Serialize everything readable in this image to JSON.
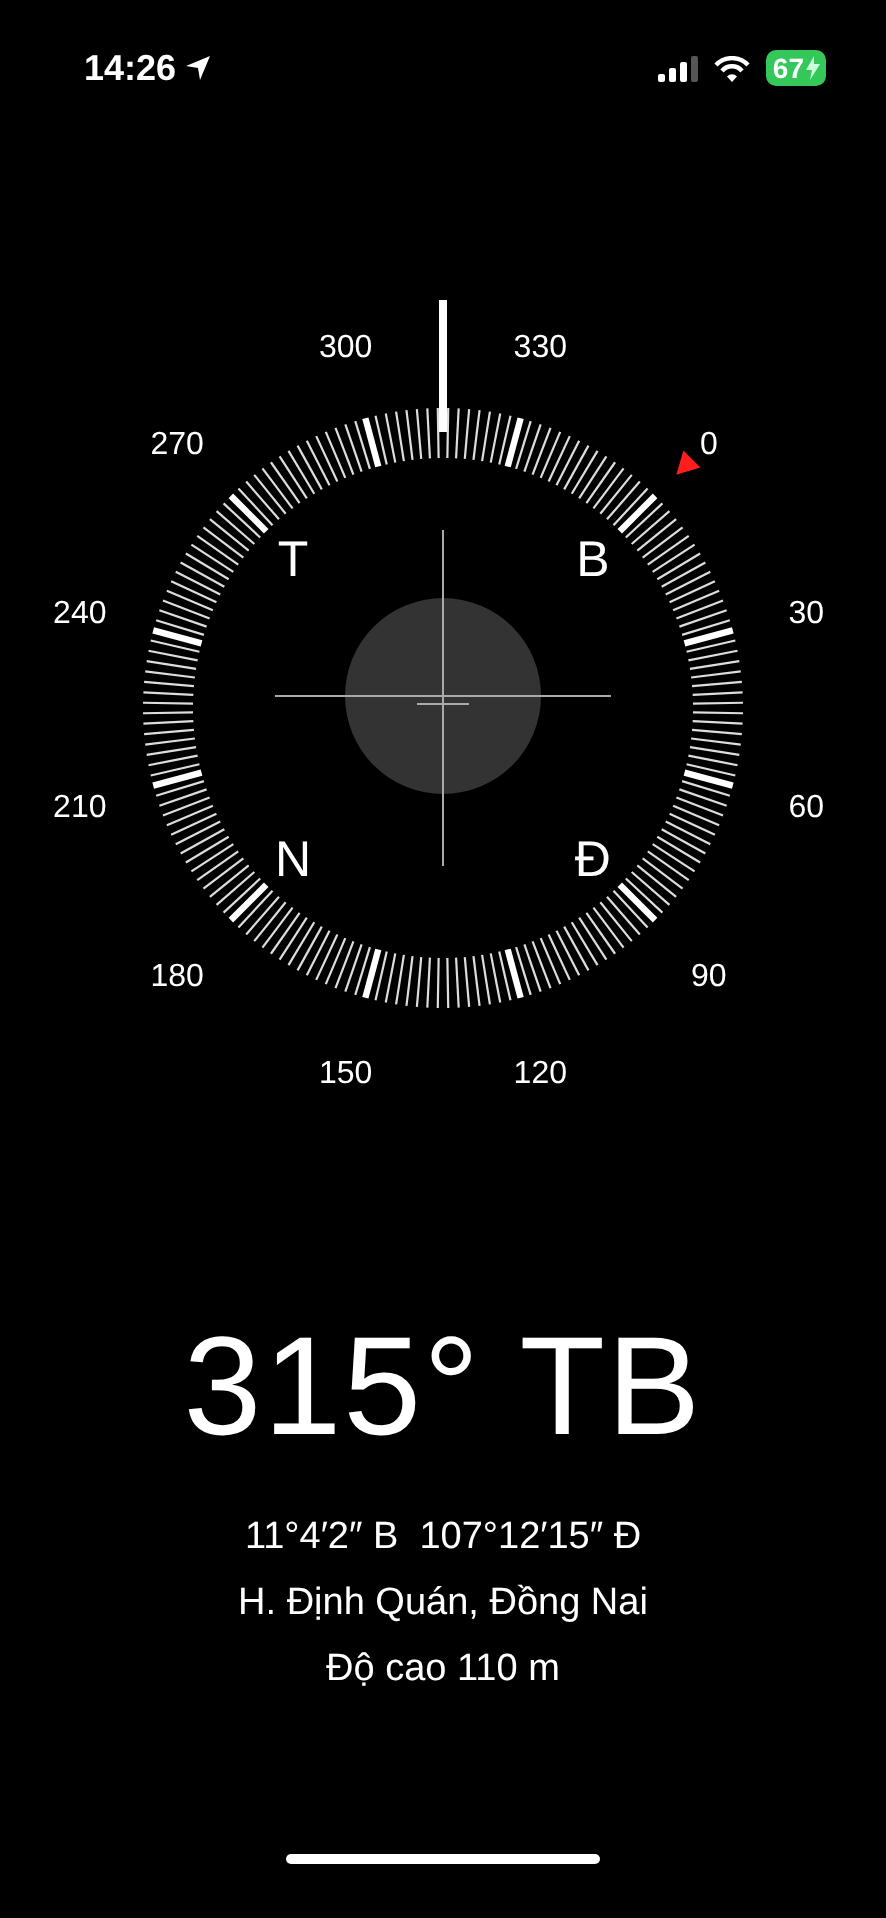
{
  "status_bar": {
    "time": "14:26",
    "battery": "67"
  },
  "compass": {
    "dial_labels": [
      {
        "text": "0"
      },
      {
        "text": "30"
      },
      {
        "text": "60"
      },
      {
        "text": "90"
      },
      {
        "text": "120"
      },
      {
        "text": "150"
      },
      {
        "text": "180"
      },
      {
        "text": "210"
      },
      {
        "text": "240"
      },
      {
        "text": "270"
      },
      {
        "text": "300"
      },
      {
        "text": "330"
      }
    ],
    "cardinals": [
      {
        "text": "T"
      },
      {
        "text": "B"
      },
      {
        "text": "N"
      },
      {
        "text": "Đ"
      }
    ]
  },
  "heading": "315° TB",
  "coordinates": {
    "latitude": "11°4′2″ B",
    "longitude": "107°12′15″ Đ"
  },
  "location": "H. Định Quán, Đồng Nai",
  "elevation": "Độ cao 110 m"
}
